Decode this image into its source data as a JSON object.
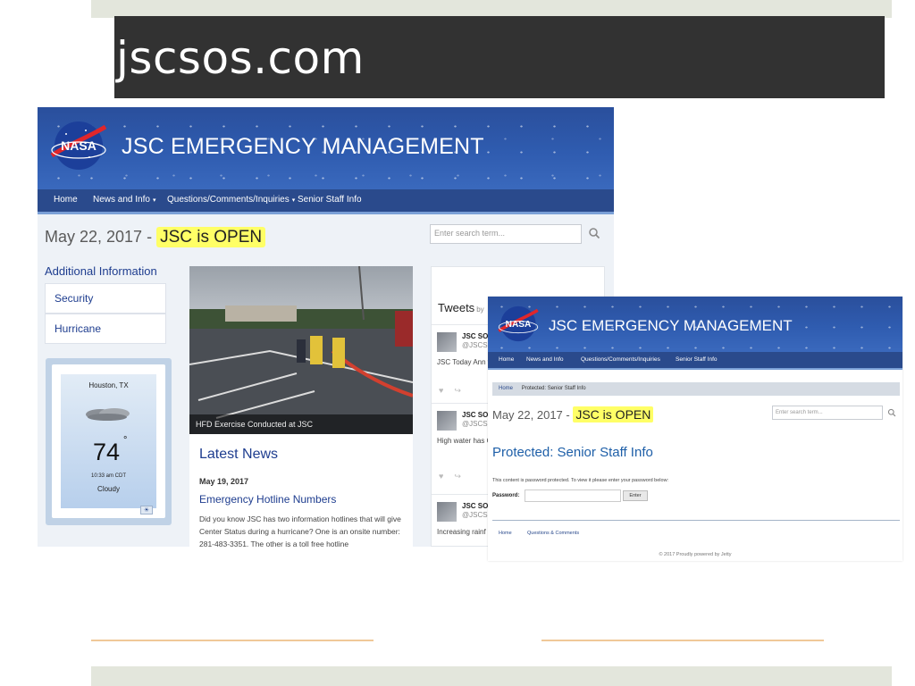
{
  "slide": {
    "title": "jscsos.com"
  },
  "site1": {
    "banner_title": "JSC EMERGENCY MANAGEMENT",
    "nav": [
      {
        "label": "Home",
        "dropdown": false
      },
      {
        "label": "News and Info",
        "dropdown": true
      },
      {
        "label": "Questions/Comments/Inquiries",
        "dropdown": true
      },
      {
        "label": "Senior Staff Info",
        "dropdown": false
      }
    ],
    "date_prefix": "May 22, 2017 -",
    "status": "JSC is OPEN",
    "search_placeholder": "Enter search term...",
    "additional_heading": "Additional Information",
    "side_links": [
      "Security",
      "Hurricane"
    ],
    "weather": {
      "city": "Houston, TX",
      "temp": "74",
      "degree": "°",
      "time": "10:33 am CDT",
      "condition": "Cloudy"
    },
    "photo_caption": "HFD Exercise Conducted at JSC",
    "latest_news": {
      "heading": "Latest News",
      "date": "May 19, 2017",
      "headline": "Emergency Hotline Numbers",
      "body": "Did you know JSC has two information hotlines that will give Center Status during a hurricane? One is an onsite number: 281-483-3351. The other is a toll free hotline"
    },
    "tweets": {
      "title": "Tweets",
      "by": "by",
      "items": [
        {
          "name": "JSC SO",
          "handle": "@JSCS",
          "text": "JSC Today Ann was sent via er"
        },
        {
          "name": "JSC SO",
          "handle": "@JSCS",
          "text": "High water has Gate1. Be extre drive in."
        },
        {
          "name": "JSC SO",
          "handle": "@JSCS",
          "text": "Increasing rainf are open for bu"
        }
      ]
    }
  },
  "site2": {
    "banner_title": "JSC EMERGENCY MANAGEMENT",
    "nav": [
      "Home",
      "News and Info",
      "Questions/Comments/Inquiries",
      "Senior Staff Info"
    ],
    "breadcrumb_home": "Home",
    "breadcrumb_current": "Protected: Senior Staff Info",
    "date_prefix": "May 22, 2017 -",
    "status": "JSC is OPEN",
    "search_placeholder": "Enter search term...",
    "page_title": "Protected: Senior Staff Info",
    "protected_note": "This content is password protected. To view it please enter your password below:",
    "password_label": "Password:",
    "enter_label": "Enter",
    "footer_links": [
      "Home",
      "Questions & Comments"
    ],
    "copyright": "© 2017 Proudly powered by Jetty"
  }
}
